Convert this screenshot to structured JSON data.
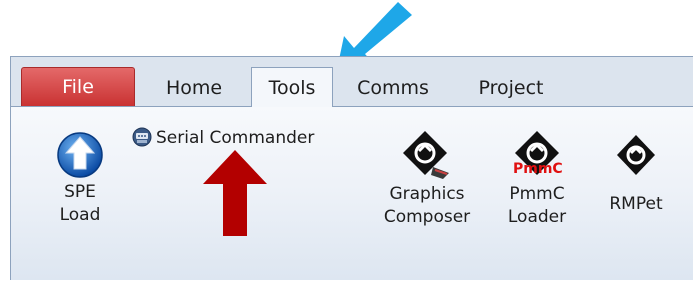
{
  "tabs": {
    "file": "File",
    "home": "Home",
    "tools": "Tools",
    "comms": "Comms",
    "project": "Project"
  },
  "ribbon": {
    "spe_load": {
      "line1": "SPE",
      "line2": "Load"
    },
    "serial_commander": "Serial Commander",
    "graphics_composer": {
      "line1": "Graphics",
      "line2": "Composer"
    },
    "pmmc_loader": {
      "line1": "PmmC",
      "line2": "Loader",
      "badge": "PmmC"
    },
    "rmpet": "RMPet"
  },
  "colors": {
    "file_tab": "#c93232",
    "callout_blue": "#1ea7e8",
    "callout_red": "#b30000"
  },
  "icons": {
    "spe_load": "upload-circle-icon",
    "serial_commander": "serial-commander-icon",
    "graphics_composer": "graphics-composer-icon",
    "pmmc_loader": "pmmc-loader-icon",
    "rmpet": "rmpet-icon"
  }
}
